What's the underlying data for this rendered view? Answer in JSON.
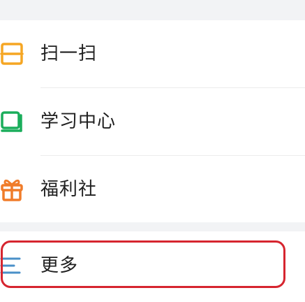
{
  "menu": {
    "items": [
      {
        "label": "扫一扫",
        "icon": "scan-icon",
        "color": "#f5a623"
      },
      {
        "label": "学习中心",
        "icon": "book-icon",
        "color": "#1aad5b"
      },
      {
        "label": "福利社",
        "icon": "gift-icon",
        "color": "#f07c2a"
      }
    ],
    "more": {
      "label": "更多",
      "icon": "more-lines-icon",
      "color": "#4a90c8"
    }
  },
  "colors": {
    "background": "#f2f3f5",
    "card": "#ffffff",
    "highlight_border": "#d6252f"
  }
}
